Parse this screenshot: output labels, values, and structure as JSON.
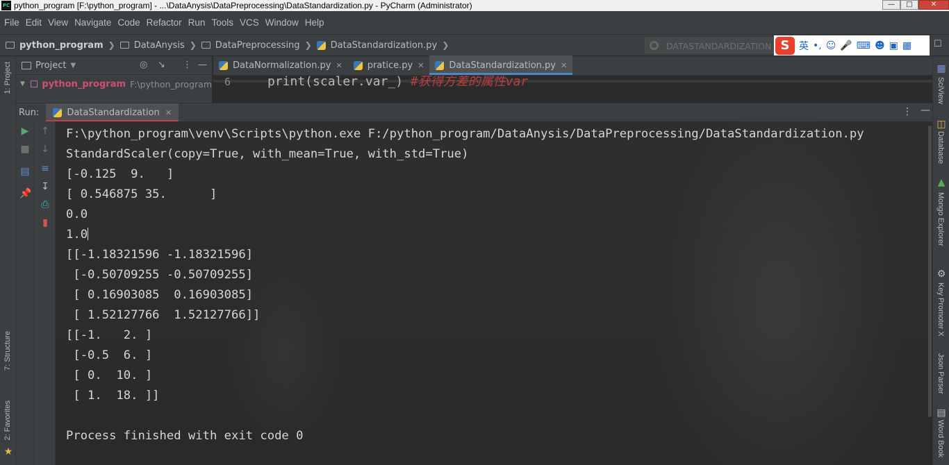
{
  "window": {
    "title": "python_program [F:\\python_program] - ...\\DataAnysis\\DataPreprocessing\\DataStandardization.py - PyCharm (Administrator)",
    "app_icon_text": "PC"
  },
  "menu": [
    "File",
    "Edit",
    "View",
    "Navigate",
    "Code",
    "Refactor",
    "Run",
    "Tools",
    "VCS",
    "Window",
    "Help"
  ],
  "breadcrumb": {
    "project": "python_program",
    "folder1": "DataAnysis",
    "folder2": "DataPreprocessing",
    "file": "DataStandardization.py"
  },
  "run_config": {
    "label": "DATASTANDARDIZATION"
  },
  "ime": {
    "logo": "S",
    "lang": "英"
  },
  "left_strip": {
    "project": "1: Project",
    "structure": "7: Structure",
    "favorites": "2: Favorites"
  },
  "right_strip": {
    "sciview": "SciView",
    "database": "Database",
    "mongo": "Mongo Explorer",
    "keypromoter": "Key Promoter X",
    "jsonparser": "Json Parser",
    "wordbook": "Word Book"
  },
  "project_panel": {
    "label": "Project",
    "root_name": "python_program",
    "root_path": "F:\\python_program"
  },
  "editor_tabs": [
    {
      "label": "DataNormalization.py"
    },
    {
      "label": "pratice.py"
    },
    {
      "label": "DataStandardization.py"
    }
  ],
  "editor_peek": {
    "line_number": "6",
    "code": "print(scaler.var_)",
    "comment": "#获得方差的属性var"
  },
  "run_panel": {
    "label": "Run:",
    "tab": "DataStandardization"
  },
  "console": {
    "lines": [
      "F:\\python_program\\venv\\Scripts\\python.exe F:/python_program/DataAnysis/DataPreprocessing/DataStandardization.py",
      "StandardScaler(copy=True, with_mean=True, with_std=True)",
      "[-0.125  9.   ]",
      "[ 0.546875 35.      ]",
      "0.0",
      "1.0",
      "[[-1.18321596 -1.18321596]",
      " [-0.50709255 -0.50709255]",
      " [ 0.16903085  0.16903085]",
      " [ 1.52127766  1.52127766]]",
      "[[-1.   2. ]",
      " [-0.5  6. ]",
      " [ 0.  10. ]",
      " [ 1.  18. ]]",
      "",
      "Process finished with exit code 0"
    ]
  },
  "colors": {
    "ide_bg": "#3c3f41",
    "console_bg": "#2b2b2b",
    "project_name": "#d04f74",
    "run_tab_underline": "#c83c49",
    "editor_tab_underline": "#4a88c7"
  }
}
